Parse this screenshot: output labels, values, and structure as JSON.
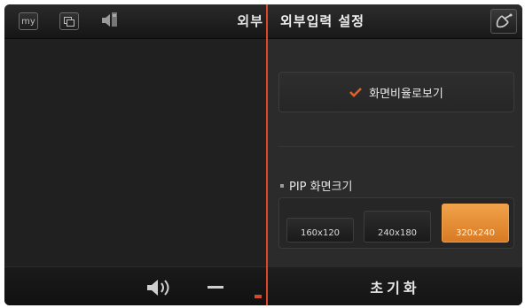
{
  "toolbar": {
    "my_label": "my",
    "left_title": "외부",
    "icons": [
      "my-icon",
      "window-icon",
      "speaker-icon"
    ]
  },
  "settings": {
    "title": "외부입력 설정",
    "close_icon": "satellite-dish-icon",
    "aspect_ratio": {
      "label": "화면비율로보기",
      "checked": true
    },
    "pip": {
      "label": "PIP 화면크기",
      "options": [
        "160x120",
        "240x180",
        "320x240"
      ],
      "selected": "320x240"
    },
    "reset_label": "초기화"
  },
  "colors": {
    "accent": "#e0442a",
    "selected": "#e08a34",
    "panel": "#2b2b2b"
  }
}
